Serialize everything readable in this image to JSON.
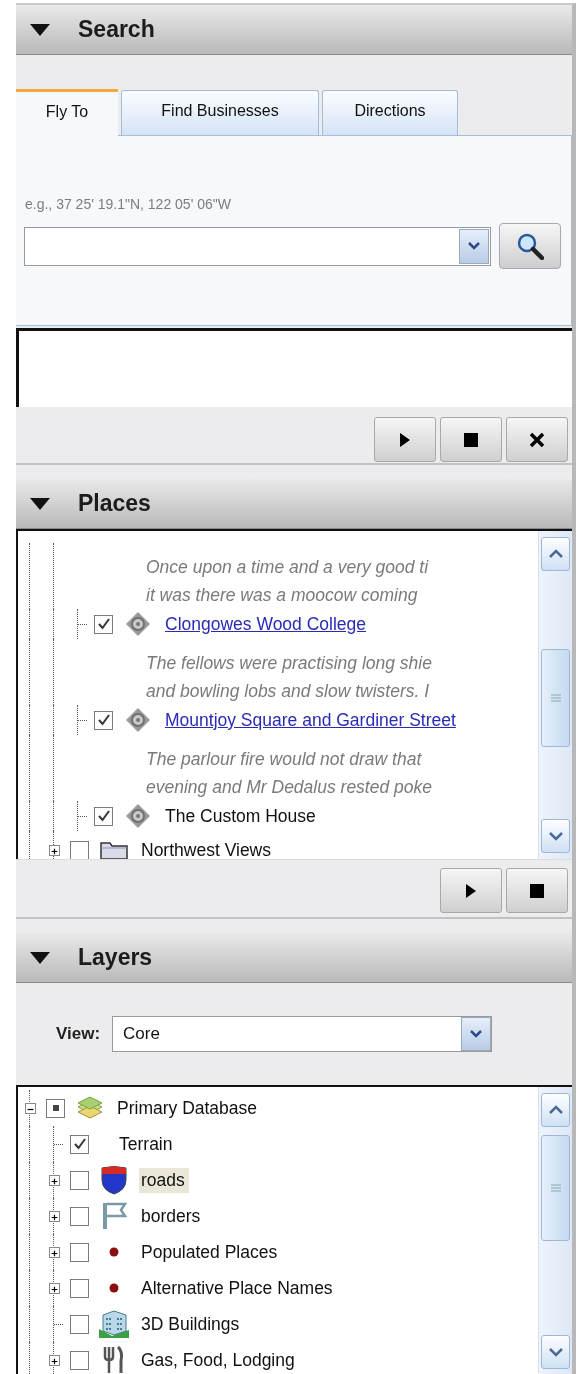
{
  "search": {
    "title": "Search",
    "expanded": true,
    "tabs": [
      {
        "label": "Fly To",
        "selected": true
      },
      {
        "label": "Find Businesses",
        "selected": false
      },
      {
        "label": "Directions",
        "selected": false
      }
    ],
    "hint": "e.g., 37 25' 19.1\"N, 122 05' 06\"W",
    "buttons": [
      {
        "kind": "play"
      },
      {
        "kind": "stop"
      },
      {
        "kind": "close"
      }
    ]
  },
  "places": {
    "title": "Places",
    "expanded": true,
    "tree": [
      {
        "kind": "group",
        "children": [
          {
            "kind": "group",
            "children": [
              {
                "kind": "description",
                "lines": [
                  "Once upon a time and a very good ti",
                  "it was there was a moocow coming"
                ]
              },
              {
                "kind": "placemark",
                "label": "Clongowes Wood College",
                "link": true,
                "checked": true
              },
              {
                "kind": "description",
                "lines": [
                  "The fellows were practising long shie",
                  "and bowling lobs and slow twisters. I"
                ]
              },
              {
                "kind": "placemark",
                "label": "Mountjoy Square and Gardiner Street",
                "link": true,
                "checked": true
              },
              {
                "kind": "description",
                "lines": [
                  "The parlour fire would not draw that",
                  "evening and Mr Dedalus rested poke"
                ]
              },
              {
                "kind": "placemark",
                "label": "The Custom House",
                "link": false,
                "checked": true
              }
            ]
          },
          {
            "kind": "folder",
            "label": "Northwest Views",
            "checked": false,
            "expandable": true,
            "expanded": false
          }
        ]
      }
    ],
    "buttons": [
      {
        "kind": "play"
      },
      {
        "kind": "stop"
      }
    ]
  },
  "layers": {
    "title": "Layers",
    "expanded": true,
    "view_label": "View:",
    "view": "Core",
    "tree": [
      {
        "kind": "database",
        "label": "Primary Database",
        "checked": true,
        "mixed": true,
        "expandable": true,
        "expanded": true,
        "selected": false,
        "children": [
          {
            "kind": "plain",
            "label": "Terrain",
            "checked": true,
            "expandable": false,
            "selected": false
          },
          {
            "kind": "road",
            "label": "roads",
            "checked": false,
            "expandable": true,
            "expanded": false,
            "selected": true
          },
          {
            "kind": "flag",
            "label": "borders",
            "checked": false,
            "expandable": true,
            "expanded": false,
            "selected": false
          },
          {
            "kind": "dot",
            "label": "Populated Places",
            "checked": false,
            "expandable": true,
            "expanded": false,
            "selected": false
          },
          {
            "kind": "dot",
            "label": "Alternative Place Names",
            "checked": false,
            "expandable": true,
            "expanded": false,
            "selected": false
          },
          {
            "kind": "building",
            "label": "3D Buildings",
            "checked": false,
            "expandable": false,
            "selected": false
          },
          {
            "kind": "food",
            "label": "Gas, Food, Lodging",
            "checked": false,
            "expandable": true,
            "expanded": false,
            "selected": false
          }
        ]
      }
    ]
  }
}
